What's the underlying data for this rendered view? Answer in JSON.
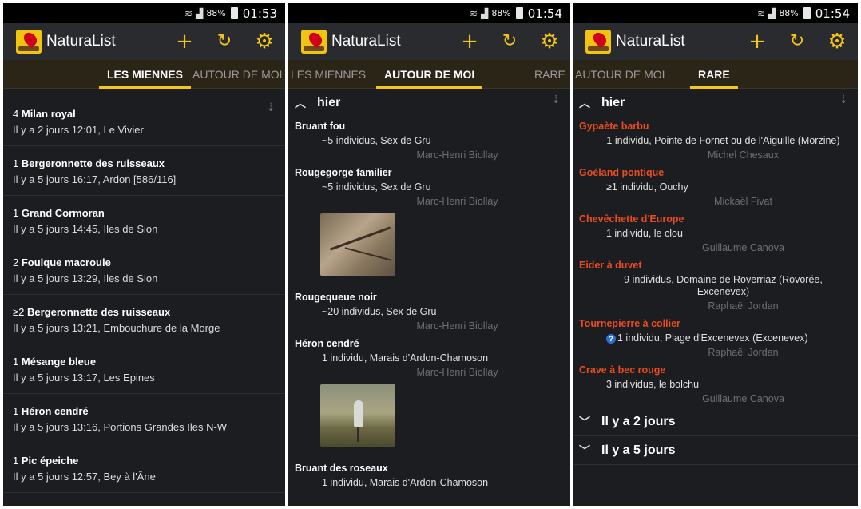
{
  "statusbar": [
    {
      "battery": "88%",
      "time": "01:53"
    },
    {
      "battery": "88%",
      "time": "01:54"
    },
    {
      "battery": "88%",
      "time": "01:54"
    }
  ],
  "app": {
    "title": "NaturaList",
    "accent": "#f5c518",
    "rare_color": "#e84c1f",
    "icons": [
      "add-icon",
      "refresh-location-icon",
      "settings-gear-icon"
    ]
  },
  "tabs": {
    "mine": "LES MIENNES",
    "around": "AUTOUR DE MOI",
    "rare": "RARE"
  },
  "screen1": {
    "items": [
      {
        "count": "4",
        "species": "Milan royal",
        "sub": "Il y a 2 jours 12:01, Le Vivier"
      },
      {
        "count": "1",
        "species": "Bergeronnette des ruisseaux",
        "sub": "Il y a 5 jours 16:17, Ardon [586/116]"
      },
      {
        "count": "1",
        "species": "Grand Cormoran",
        "sub": "Il y a 5 jours 14:45, Iles de Sion"
      },
      {
        "count": "2",
        "species": "Foulque macroule",
        "sub": "Il y a 5 jours 13:29, Iles de Sion"
      },
      {
        "count": "≥2",
        "species": "Bergeronnette des ruisseaux",
        "sub": "Il y a 5 jours 13:21, Embouchure de la Morge"
      },
      {
        "count": "1",
        "species": "Mésange bleue",
        "sub": "Il y a 5 jours 13:17, Les Epines"
      },
      {
        "count": "1",
        "species": "Héron cendré",
        "sub": "Il y a 5 jours 13:16, Portions Grandes Iles N-W"
      },
      {
        "count": "1",
        "species": "Pic épeiche",
        "sub": "Il y a 5 jours 12:57, Bey à l'Âne"
      }
    ]
  },
  "screen2": {
    "group": "hier",
    "obs": [
      {
        "species": "Bruant fou",
        "detail": "~5 individus, Sex de Gru",
        "observer": "Marc-Henri Biollay"
      },
      {
        "species": "Rougegorge familier",
        "detail": "~5 individus, Sex de Gru",
        "observer": "Marc-Henri Biollay"
      },
      {
        "species": "Rougequeue noir",
        "detail": "~20 individus, Sex de Gru",
        "observer": "Marc-Henri Biollay"
      },
      {
        "species": "Héron cendré",
        "detail": "1 individu, Marais d'Ardon-Chamoson",
        "observer": "Marc-Henri Biollay"
      },
      {
        "species": "Bruant des roseaux",
        "detail": "1 individu, Marais d'Ardon-Chamoson",
        "observer": ""
      }
    ]
  },
  "screen3": {
    "group": "hier",
    "obs": [
      {
        "species": "Gypaète barbu",
        "detail": "1 individu, Pointe de Fornet ou de l'Aiguille (Morzine)",
        "observer": "Michel Chesaux"
      },
      {
        "species": "Goéland pontique",
        "detail": "≥1 individu, Ouchy",
        "observer": "Mickaël Fivat"
      },
      {
        "species": "Chevêchette d'Europe",
        "detail": "1 individu, le clou",
        "observer": "Guillaume Canova"
      },
      {
        "species": "Eider à duvet",
        "detail": "9 individus, Domaine de Roverriaz (Rovorée, Excenevex)",
        "observer": "Raphaël Jordan"
      },
      {
        "species": "Tournepierre à collier",
        "detail": "1 individu, Plage d'Excenevex (Excenevex)",
        "observer": "Raphaël Jordan"
      },
      {
        "species": "Crave à bec rouge",
        "detail": "3 individus, le bolchu",
        "observer": "Guillaume Canova"
      }
    ],
    "collapsed_groups": [
      "Il y a 2 jours",
      "Il y a 5 jours"
    ]
  }
}
